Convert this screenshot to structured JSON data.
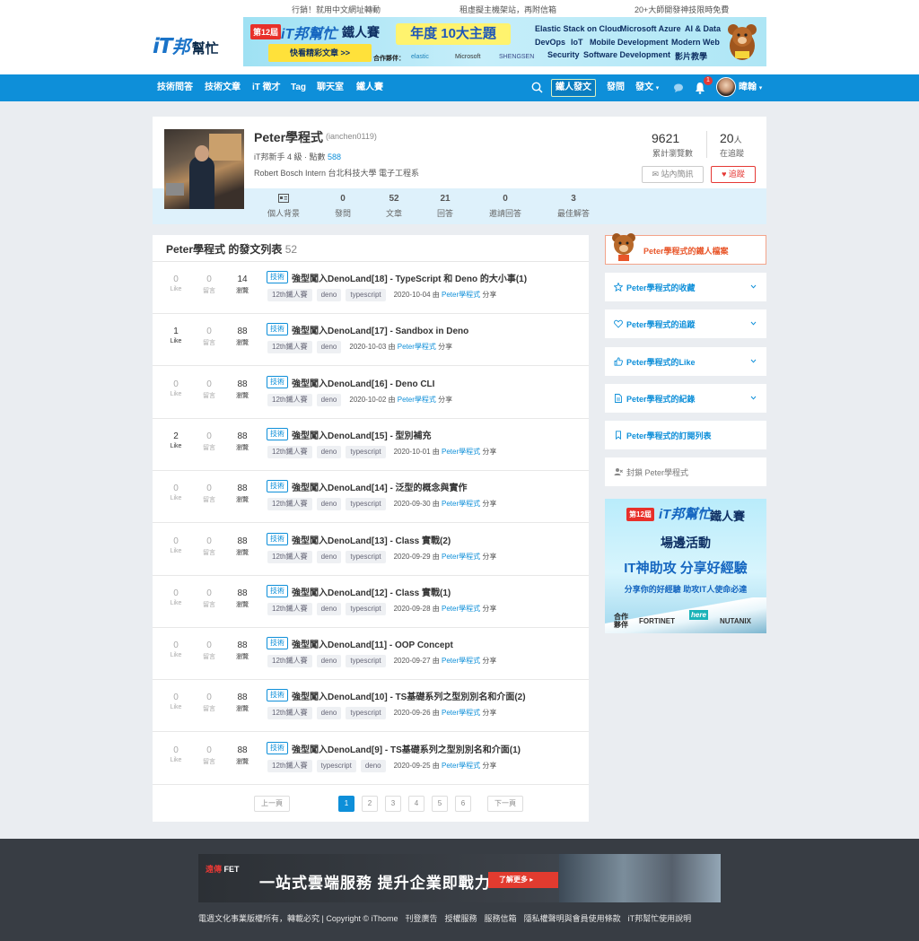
{
  "top_links": [
    "行銷！就用中文網址轉動",
    "租虛擬主機架站，再附信箱",
    "20+大師開發神技限時免費"
  ],
  "logo": {
    "it": "iT",
    "bang": "邦",
    "help": "幫忙"
  },
  "top_banner": {
    "edition": "第12屆",
    "logo": "iT邦幫忙",
    "iron": "鐵人賽",
    "cta": "快看精彩文章 >>",
    "annual": "年度 10大主題",
    "partners_label": "合作夥伴：",
    "partners": [
      "elastic",
      "Microsoft",
      "SHENGSEN"
    ],
    "topics_row1": [
      "Elastic Stack on Cloud",
      "Microsoft Azure",
      "AI & Data"
    ],
    "topics_row2": [
      "DevOps",
      "IoT",
      "Mobile Development",
      "Modern Web"
    ],
    "topics_row3": [
      "Security",
      "Software Development",
      "影片教學"
    ]
  },
  "nav": {
    "items": [
      "技術問答",
      "技術文章",
      "iT 徵才",
      "Tag",
      "聊天室",
      "鐵人賽"
    ],
    "iron_room": "鐵人發文",
    "ask": "發問",
    "post": "發文",
    "notif_count": "1",
    "user": "暐翰"
  },
  "profile": {
    "name": "Peter學程式",
    "handle": "(ianchen0119)",
    "level": "iT邦新手 4 級 · 點數",
    "points": "588",
    "bio": "Robert Bosch Intern 台北科技大學 電子工程系",
    "views": "9621",
    "views_label": "累計瀏覽數",
    "following": "20",
    "following_unit": "人",
    "following_label": "在追蹤",
    "msg_button": "站內簡訊",
    "track_button": "追蹤",
    "stats": [
      {
        "value": "",
        "label": "個人背景"
      },
      {
        "value": "0",
        "label": "發問"
      },
      {
        "value": "52",
        "label": "文章"
      },
      {
        "value": "21",
        "label": "回答"
      },
      {
        "value": "0",
        "label": "邀請回答"
      },
      {
        "value": "3",
        "label": "最佳解答"
      }
    ]
  },
  "list": {
    "title": "Peter學程式 的發文列表",
    "count": "52",
    "like_label": "Like",
    "comment_label": "留言",
    "view_label": "瀏覽",
    "tech_label": "技術",
    "author": "Peter學程式",
    "by": "由",
    "share": "分享",
    "rows": [
      {
        "like": "0",
        "comment": "0",
        "view": "14",
        "title": "強型闖入DenoLand[18] - TypeScript 和 Deno 的大小事(1)",
        "tags": [
          "12th鐵人賽",
          "deno",
          "typescript"
        ],
        "date": "2020-10-04"
      },
      {
        "like": "1",
        "comment": "0",
        "view": "88",
        "title": "強型闖入DenoLand[17] - Sandbox in Deno",
        "tags": [
          "12th鐵人賽",
          "deno"
        ],
        "date": "2020-10-03"
      },
      {
        "like": "0",
        "comment": "0",
        "view": "88",
        "title": "強型闖入DenoLand[16] - Deno CLI",
        "tags": [
          "12th鐵人賽",
          "deno"
        ],
        "date": "2020-10-02"
      },
      {
        "like": "2",
        "comment": "0",
        "view": "88",
        "title": "強型闖入DenoLand[15] - 型別補充",
        "tags": [
          "12th鐵人賽",
          "deno",
          "typescript"
        ],
        "date": "2020-10-01"
      },
      {
        "like": "0",
        "comment": "0",
        "view": "88",
        "title": "強型闖入DenoLand[14] - 泛型的概念與實作",
        "tags": [
          "12th鐵人賽",
          "deno",
          "typescript"
        ],
        "date": "2020-09-30"
      },
      {
        "like": "0",
        "comment": "0",
        "view": "88",
        "title": "強型闖入DenoLand[13] - Class 實戰(2)",
        "tags": [
          "12th鐵人賽",
          "deno",
          "typescript"
        ],
        "date": "2020-09-29"
      },
      {
        "like": "0",
        "comment": "0",
        "view": "88",
        "title": "強型闖入DenoLand[12] - Class 實戰(1)",
        "tags": [
          "12th鐵人賽",
          "deno",
          "typescript"
        ],
        "date": "2020-09-28"
      },
      {
        "like": "0",
        "comment": "0",
        "view": "88",
        "title": "強型闖入DenoLand[11] - OOP Concept",
        "tags": [
          "12th鐵人賽",
          "deno",
          "typescript"
        ],
        "date": "2020-09-27"
      },
      {
        "like": "0",
        "comment": "0",
        "view": "88",
        "title": "強型闖入DenoLand[10] - TS基礎系列之型別別名和介面(2)",
        "tags": [
          "12th鐵人賽",
          "deno",
          "typescript"
        ],
        "date": "2020-09-26"
      },
      {
        "like": "0",
        "comment": "0",
        "view": "88",
        "title": "強型闖入DenoLand[9] - TS基礎系列之型別別名和介面(1)",
        "tags": [
          "12th鐵人賽",
          "typescript",
          "deno"
        ],
        "date": "2020-09-25"
      }
    ]
  },
  "pager": {
    "prev": "上一頁",
    "pages": [
      "1",
      "2",
      "3",
      "4",
      "5",
      "6"
    ],
    "next": "下一頁",
    "active": "1"
  },
  "sidebar": {
    "iron": "Peter學程式的鐵人檔案",
    "items": [
      {
        "label": "Peter學程式的收藏",
        "icon": "star-icon"
      },
      {
        "label": "Peter學程式的追蹤",
        "icon": "heart-icon"
      },
      {
        "label": "Peter學程式的Like",
        "icon": "thumbs-up-icon"
      },
      {
        "label": "Peter學程式的紀錄",
        "icon": "file-icon"
      },
      {
        "label": "Peter學程式的訂閱列表",
        "icon": "bookmark-icon"
      },
      {
        "label": "封鎖 Peter學程式",
        "icon": "block-user-icon"
      }
    ],
    "ad": {
      "edition": "第12屆",
      "logo": "iT邦幫忙",
      "iron": "鐵人賽",
      "event": "場邊活動",
      "slogan": "IT神助攻 分享好經驗",
      "sub": "分享你的好經驗 助攻IT人使命必達",
      "partner_label": "合作夥伴",
      "partners": [
        "FORTINET",
        "here",
        "NUTANIX"
      ]
    }
  },
  "footer": {
    "ad": {
      "logo_a": "遠傳",
      "logo_b": "FET",
      "text": "一站式雲端服務  提升企業即戰力",
      "button": "了解更多 ▸"
    },
    "copyright": "電週文化事業版權所有，轉載必究 | Copyright © iThome",
    "links": [
      "刊登廣告",
      "授權服務",
      "服務信箱",
      "隱私權聲明與會員使用條款",
      "iT邦幫忙使用說明"
    ]
  },
  "colors": {
    "primary": "#0e8fd9",
    "accent_red": "#e53935",
    "footer_bg": "#383d44",
    "page_bg": "#eaedf1"
  }
}
